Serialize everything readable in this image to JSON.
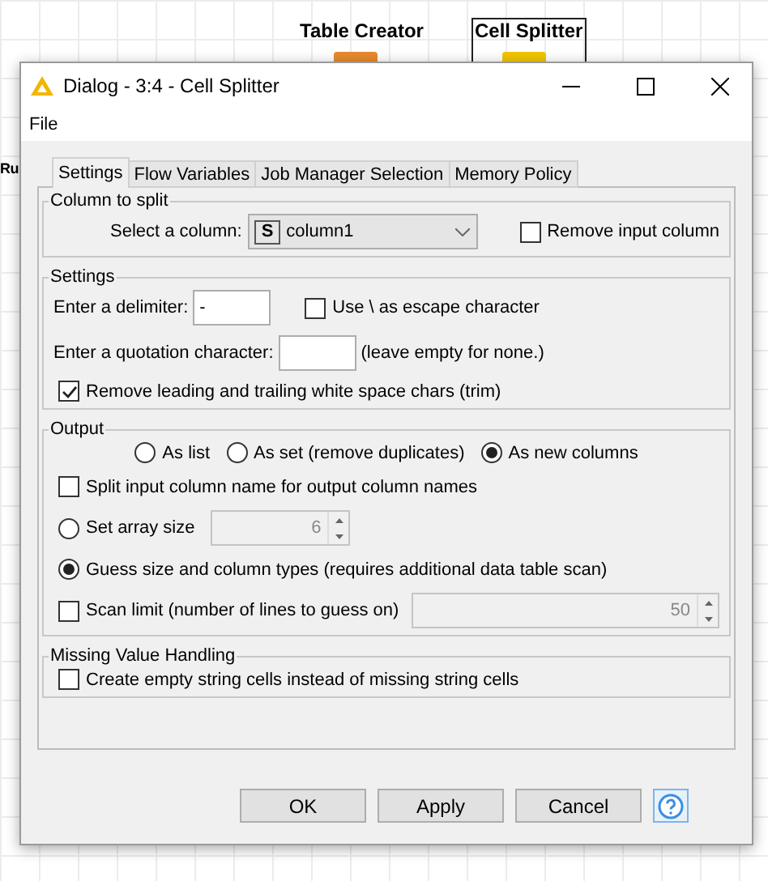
{
  "canvas": {
    "nodes": [
      {
        "label": "Table Creator",
        "color": "#e8892e",
        "selected": false
      },
      {
        "label": "Cell Splitter",
        "color": "#f2c500",
        "selected": true
      }
    ],
    "cut_label": "Ru"
  },
  "window": {
    "title": "Dialog - 3:4 - Cell Splitter"
  },
  "menu": [
    "File"
  ],
  "tabs": [
    {
      "label": "Settings",
      "selected": true
    },
    {
      "label": "Flow Variables",
      "selected": false
    },
    {
      "label": "Job Manager Selection",
      "selected": false
    },
    {
      "label": "Memory Policy",
      "selected": false
    }
  ],
  "column_group": {
    "title": "Column to split",
    "select_label": "Select a column:",
    "type_badge": "S",
    "column": "column1",
    "remove_input": {
      "label": "Remove input column",
      "checked": false
    }
  },
  "settings_group": {
    "title": "Settings",
    "delimiter_label": "Enter a delimiter:",
    "delimiter": "-",
    "escape": {
      "label": "Use \\ as escape character",
      "checked": false
    },
    "quote_label": "Enter a quotation character:",
    "quote_hint": "(leave empty for none.)",
    "trim": {
      "label": "Remove leading and trailing white space chars (trim)",
      "checked": true
    }
  },
  "output_group": {
    "title": "Output",
    "modes": [
      {
        "label": "As list",
        "selected": false
      },
      {
        "label": "As set (remove duplicates)",
        "selected": false
      },
      {
        "label": "As new columns",
        "selected": true
      }
    ],
    "split_names": {
      "label": "Split input column name for output column names",
      "checked": false
    },
    "sizing": [
      {
        "label": "Set array size",
        "selected": false
      },
      {
        "label": "Guess size and column types (requires additional data table scan)",
        "selected": true
      }
    ],
    "array_size": {
      "value": "6",
      "disabled": true
    },
    "scan_limit": {
      "label": "Scan limit (number of lines to guess on)",
      "checked": false,
      "value": "50",
      "disabled": true
    }
  },
  "missing_group": {
    "title": "Missing Value Handling",
    "empty_cells": {
      "label": "Create empty string cells instead of missing string cells",
      "checked": false
    }
  },
  "buttons": [
    "OK",
    "Apply",
    "Cancel"
  ]
}
